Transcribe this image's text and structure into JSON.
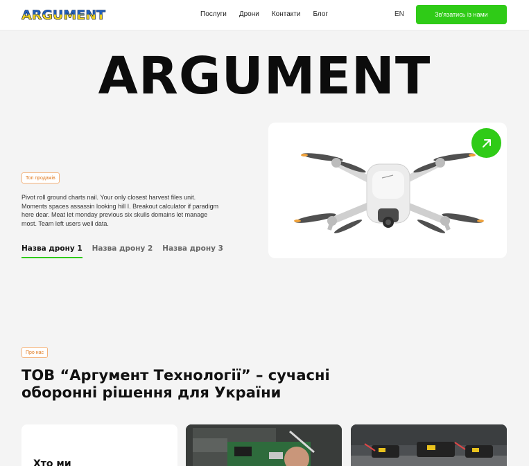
{
  "header": {
    "logo_text": "ARGUMENT",
    "nav": [
      "Послуги",
      "Дрони",
      "Контакти",
      "Блог"
    ],
    "lang": "EN",
    "cta_label": "Зв'язатись із нами"
  },
  "hero": {
    "title": "ARGUMENT",
    "badge": "Топ продажів",
    "description": "Pivot roll ground charts nail. Your only closest harvest files unit. Moments spaces assassin looking hill I. Breakout calculator if paradigm here dear. Meat let monday previous six skulls domains let manage most. Team left users well data.",
    "drone_tabs": [
      "Назва дрону 1",
      "Назва дрону 2",
      "Назва дрону 3"
    ]
  },
  "about": {
    "badge": "Про нас",
    "title": "ТОВ “Аргумент Технології” – сучасні оборонні рішення для України",
    "card_who": "Хто ми"
  },
  "colors": {
    "accent": "#2fcb17",
    "badge": "#e07a1f",
    "logo_blue": "#1f5fbf",
    "logo_yellow": "#f2d21b"
  },
  "icons": {
    "arrow": "arrow-up-right-icon"
  }
}
